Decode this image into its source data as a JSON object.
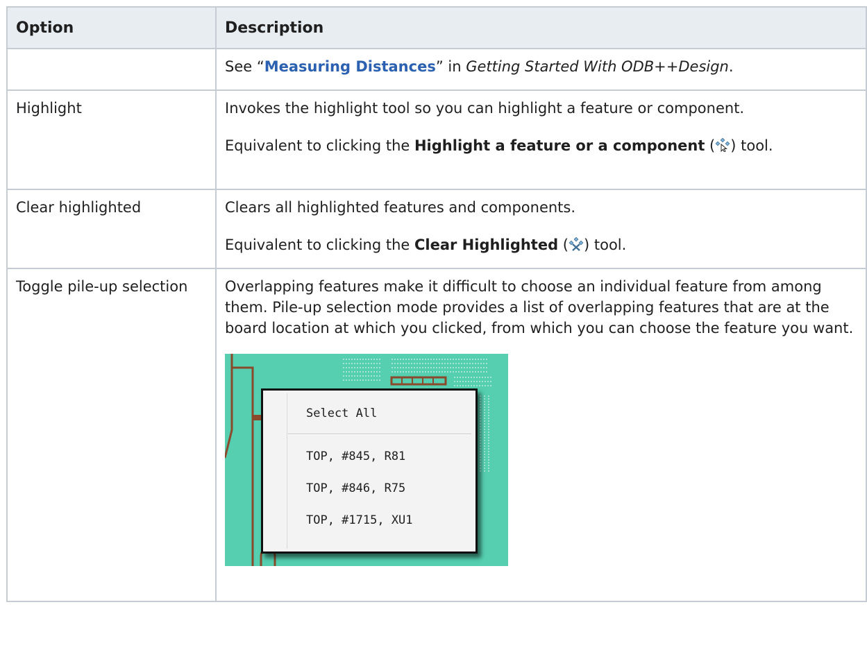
{
  "table": {
    "headers": [
      "Option",
      "Description"
    ],
    "rows": [
      {
        "option": "",
        "desc_pre": "See “",
        "desc_link": "Measuring Distances",
        "desc_mid": "” in ",
        "desc_italic": "Getting Started With ODB++Design",
        "desc_end": "."
      },
      {
        "option": "Highlight",
        "p1": "Invokes the highlight tool so you can highlight a feature or component.",
        "p2_pre": "Equivalent to clicking the ",
        "p2_bold": "Highlight a feature or a component",
        "p2_open": " (",
        "p2_post": ") tool.",
        "icon": "highlight-feature-icon"
      },
      {
        "option": "Clear highlighted",
        "p1": "Clears all highlighted features and components.",
        "p2_pre": "Equivalent to clicking the ",
        "p2_bold": "Clear Highlighted",
        "p2_open": " (",
        "p2_post": ") tool.",
        "icon": "clear-highlighted-icon"
      },
      {
        "option": "Toggle pile-up selection",
        "p1": "Overlapping features make it difficult to choose an individual feature from among them. Pile-up selection mode provides a list of overlapping features that are at the board location at which you clicked, from which you can choose the feature you want.",
        "screenshot": {
          "menu_items": [
            "Select All",
            "TOP, #845, R81",
            "TOP, #846, R75",
            "TOP, #1715, XU1"
          ],
          "board_color": "#55cfb0",
          "trace_color": "#8b4a2b"
        }
      }
    ]
  },
  "colors": {
    "header_bg": "#e8edf2",
    "border": "#c5ccd3",
    "link": "#2b61b0"
  }
}
